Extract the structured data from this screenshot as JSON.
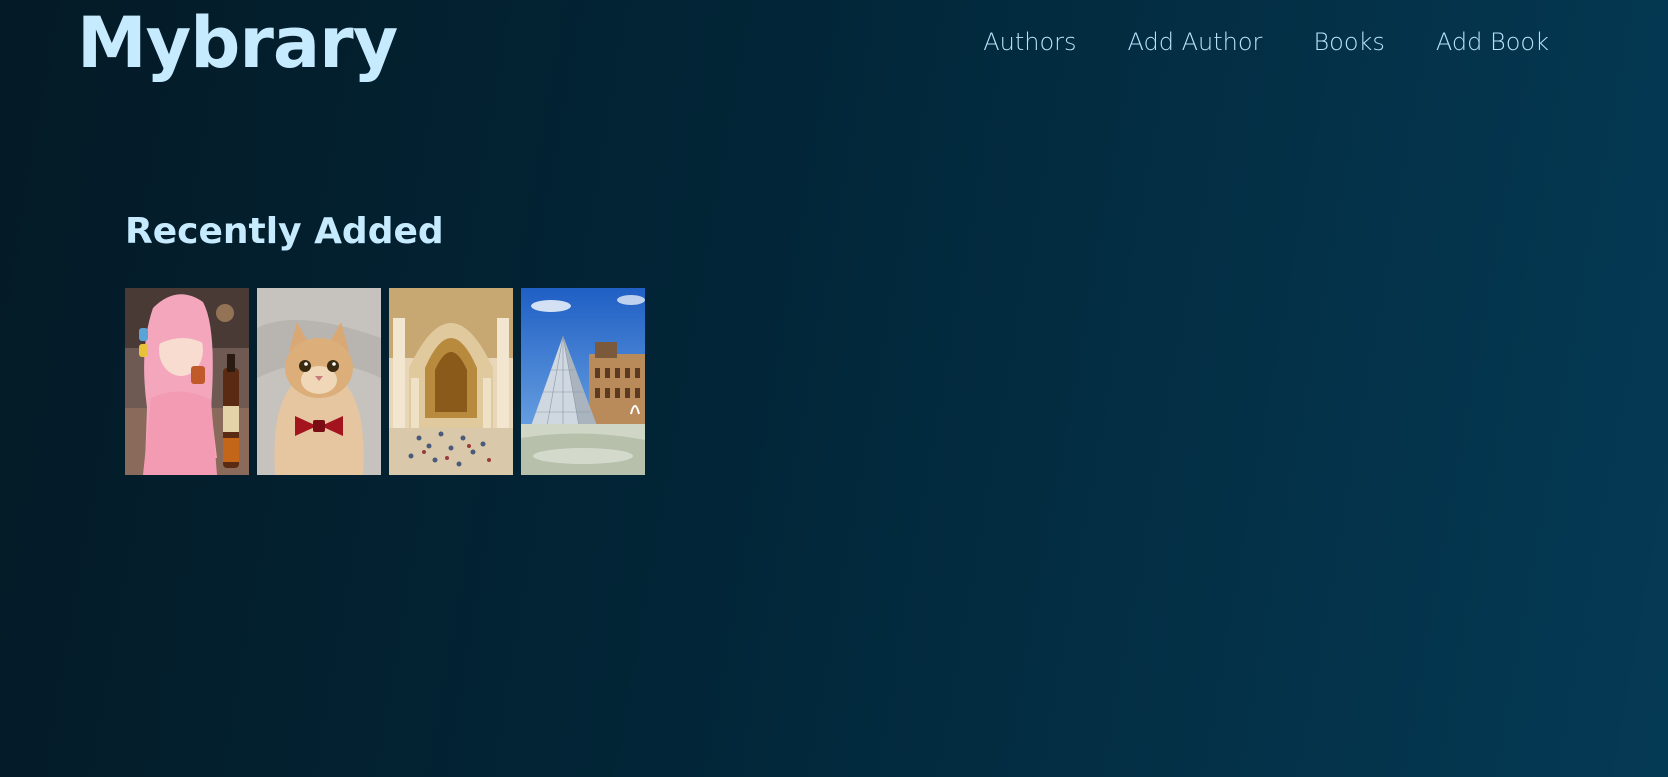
{
  "header": {
    "logo": "Mybrary",
    "nav": [
      {
        "label": "Authors"
      },
      {
        "label": "Add Author"
      },
      {
        "label": "Books"
      },
      {
        "label": "Add Book"
      }
    ]
  },
  "main": {
    "section_title": "Recently Added",
    "books": [
      {
        "cover": "anime-girl-cover-image"
      },
      {
        "cover": "cat-bowtie-cover-image"
      },
      {
        "cover": "museum-interior-cover-image"
      },
      {
        "cover": "louvre-pyramid-cover-image"
      }
    ]
  },
  "colors": {
    "accent": "#c6ebff",
    "background_start": "#041a26",
    "background_end": "#053a55"
  }
}
